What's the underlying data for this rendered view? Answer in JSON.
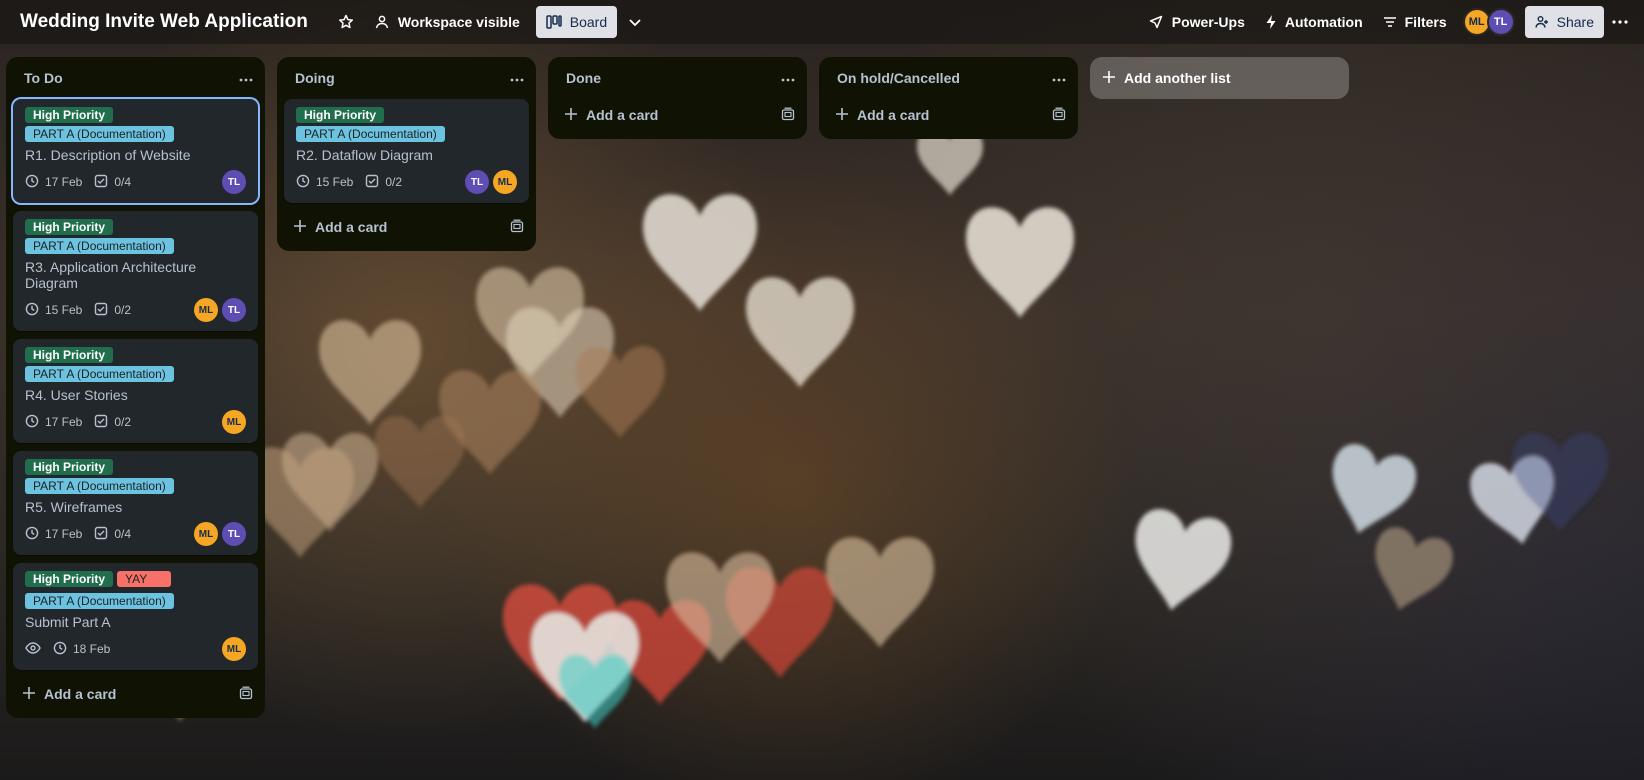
{
  "header": {
    "board_title": "Wedding Invite Web Application",
    "visibility_label": "Workspace visible",
    "view_label": "Board",
    "power_ups_label": "Power-Ups",
    "automation_label": "Automation",
    "filters_label": "Filters",
    "share_label": "Share",
    "members": [
      "ML",
      "TL"
    ]
  },
  "lists": [
    {
      "title": "To Do",
      "add_card_label": "Add a card",
      "cards": [
        {
          "labels": [
            "High Priority",
            "PART A (Documentation)"
          ],
          "title": "R1. Description of Website",
          "date": "17 Feb",
          "checklist": "0/4",
          "members": [
            "TL"
          ]
        },
        {
          "labels": [
            "High Priority",
            "PART A (Documentation)"
          ],
          "title": "R3. Application Architecture Diagram",
          "date": "15 Feb",
          "checklist": "0/2",
          "members": [
            "ML",
            "TL"
          ]
        },
        {
          "labels": [
            "High Priority",
            "PART A (Documentation)"
          ],
          "title": "R4. User Stories",
          "date": "17 Feb",
          "checklist": "0/2",
          "members": [
            "ML"
          ]
        },
        {
          "labels": [
            "High Priority",
            "PART A (Documentation)"
          ],
          "title": "R5. Wireframes",
          "date": "17 Feb",
          "checklist": "0/4",
          "members": [
            "ML",
            "TL"
          ]
        },
        {
          "labels": [
            "High Priority",
            "YAY",
            "PART A (Documentation)"
          ],
          "title": "Submit Part A",
          "date": "18 Feb",
          "members": [
            "ML"
          ]
        }
      ]
    },
    {
      "title": "Doing",
      "add_card_label": "Add a card",
      "cards": [
        {
          "labels": [
            "High Priority",
            "PART A (Documentation)"
          ],
          "title": "R2. Dataflow Diagram",
          "date": "15 Feb",
          "checklist": "0/2",
          "members": [
            "TL",
            "ML"
          ]
        }
      ]
    },
    {
      "title": "Done",
      "add_card_label": "Add a card",
      "cards": []
    },
    {
      "title": "On hold/Cancelled",
      "add_card_label": "Add a card",
      "cards": []
    }
  ],
  "add_list_label": "Add another list",
  "colors": {
    "list_bg": "#101204",
    "card_bg": "#22272b",
    "label_green": "#216e4e",
    "label_blue": "#6cc3e0",
    "label_red": "#f87168",
    "avatar_ml": "#f5a623",
    "avatar_tl": "#5e4db2"
  }
}
